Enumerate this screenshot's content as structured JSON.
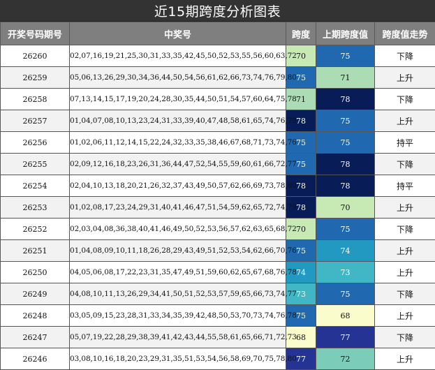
{
  "title": "近15期跨度分析图表",
  "headers": [
    "开奖号码期号",
    "中奖号",
    "跨度",
    "上期跨度值",
    "跨度值走势"
  ],
  "colors": {
    "68": "#fafccc",
    "70": "#c7e9b4",
    "71": "#abdcb3",
    "72": "#7bcdba",
    "73": "#41b6c4",
    "74": "#2299c0",
    "75": "#2069b0",
    "77": "#253494",
    "78": "#081d58"
  },
  "rows": [
    {
      "issue": "26260",
      "numbers": "02,07,16,19,21,25,30,31,33,35,42,45,50,52,53,55,56,60,63,72",
      "span": "70",
      "prev": "75",
      "trend": "下降"
    },
    {
      "issue": "26259",
      "numbers": "05,06,13,26,29,30,34,36,44,50,54,56,61,62,66,73,74,76,79,80",
      "span": "75",
      "prev": "71",
      "trend": "上升"
    },
    {
      "issue": "26258",
      "numbers": "07,13,14,15,17,19,20,24,28,30,35,44,50,51,54,57,60,64,75,78",
      "span": "71",
      "prev": "78",
      "trend": "下降"
    },
    {
      "issue": "26257",
      "numbers": "01,04,07,08,10,13,23,24,31,33,39,40,47,48,58,61,65,74,76,79",
      "span": "78",
      "prev": "75",
      "trend": "上升"
    },
    {
      "issue": "26256",
      "numbers": "01,02,06,11,12,14,15,22,24,32,33,35,38,46,67,68,71,73,74,76",
      "span": "75",
      "prev": "75",
      "trend": "持平"
    },
    {
      "issue": "26255",
      "numbers": "02,09,12,16,18,23,26,31,36,44,47,52,54,55,59,60,61,66,72,77",
      "span": "75",
      "prev": "78",
      "trend": "下降"
    },
    {
      "issue": "26254",
      "numbers": "02,04,10,13,18,20,21,26,32,37,43,49,50,57,62,66,69,73,78,80",
      "span": "78",
      "prev": "78",
      "trend": "持平"
    },
    {
      "issue": "26253",
      "numbers": "01,02,08,17,23,24,29,31,40,41,46,47,51,54,59,62,65,72,74,79",
      "span": "78",
      "prev": "70",
      "trend": "上升"
    },
    {
      "issue": "26252",
      "numbers": "02,03,04,08,36,38,40,41,46,49,50,52,53,56,57,62,63,65,68,72",
      "span": "70",
      "prev": "75",
      "trend": "下降"
    },
    {
      "issue": "26251",
      "numbers": "01,04,08,09,10,11,18,26,28,29,43,49,51,52,53,54,62,66,70,76",
      "span": "75",
      "prev": "74",
      "trend": "上升"
    },
    {
      "issue": "26250",
      "numbers": "04,05,06,08,17,22,23,31,35,47,49,51,59,60,62,65,67,68,76,78",
      "span": "74",
      "prev": "73",
      "trend": "上升"
    },
    {
      "issue": "26249",
      "numbers": "04,08,10,11,13,26,29,34,41,50,51,52,53,57,59,65,66,73,74,77",
      "span": "73",
      "prev": "75",
      "trend": "下降"
    },
    {
      "issue": "26248",
      "numbers": "03,05,09,15,23,28,31,33,34,35,39,42,48,50,53,70,73,74,76,78",
      "span": "75",
      "prev": "68",
      "trend": "上升"
    },
    {
      "issue": "26247",
      "numbers": "05,07,19,22,28,29,38,39,41,42,43,44,55,58,61,65,66,71,72,73",
      "span": "68",
      "prev": "77",
      "trend": "下降"
    },
    {
      "issue": "26246",
      "numbers": "03,08,10,16,18,20,23,29,31,35,51,53,54,56,58,69,70,75,78,80",
      "span": "77",
      "prev": "72",
      "trend": "上升"
    }
  ]
}
